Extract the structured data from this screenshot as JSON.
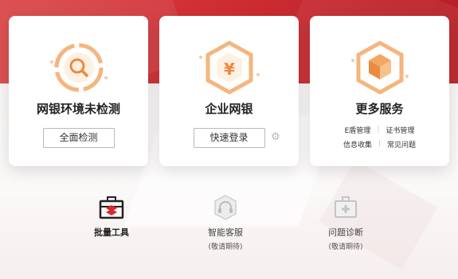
{
  "cards": [
    {
      "title": "网银环境未检测",
      "button": "全面检测",
      "icon": "search-ring-icon"
    },
    {
      "title": "企业网银",
      "button": "快速登录",
      "icon": "yen-hexagon-icon",
      "settings_icon": "gear-icon"
    },
    {
      "title": "更多服务",
      "icon": "cube-hexagon-icon",
      "links": [
        [
          "E盾管理",
          "证书管理"
        ],
        [
          "信息收集",
          "常见问题"
        ]
      ]
    }
  ],
  "tools": [
    {
      "label": "批量工具",
      "icon": "toolbox-icon",
      "sub": ""
    },
    {
      "label": "智能客服",
      "icon": "headset-icon",
      "sub": "(敬请期待)"
    },
    {
      "label": "问题诊断",
      "icon": "medical-kit-icon",
      "sub": "(敬请期待)"
    }
  ],
  "colors": {
    "header_red": "#cf2f34",
    "accent_orange": "#f3a35a",
    "text_dark": "#222222",
    "disabled_gray": "#b5b5b5"
  }
}
